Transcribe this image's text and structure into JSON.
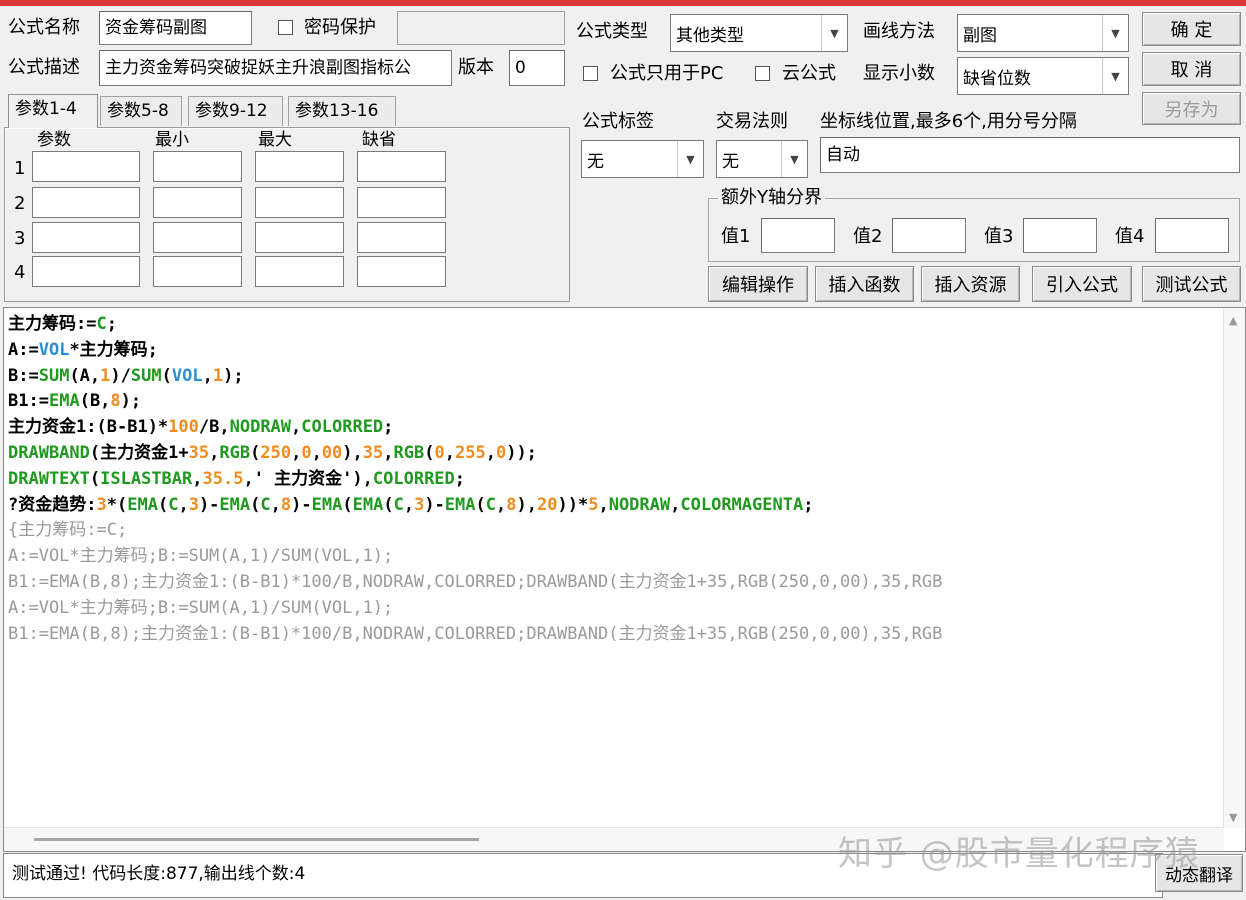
{
  "form": {
    "name_label": "公式名称",
    "name_value": "资金筹码副图",
    "password_label": "密码保护",
    "desc_label": "公式描述",
    "desc_value": "主力资金筹码突破捉妖主升浪副图指标公",
    "version_label": "版本",
    "version_value": "0",
    "type_label": "公式类型",
    "type_value": "其他类型",
    "draw_label": "画线方法",
    "draw_value": "副图",
    "pc_only_label": "公式只用于PC",
    "cloud_label": "云公式",
    "decimal_label": "显示小数",
    "decimal_value": "缺省位数",
    "tag_label": "公式标签",
    "tag_value": "无",
    "trade_label": "交易法则",
    "trade_value": "无",
    "coord_label": "坐标线位置,最多6个,用分号分隔",
    "coord_value": "自动",
    "ybound_label": "额外Y轴分界",
    "ybound_values": [
      "值1",
      "值2",
      "值3",
      "值4"
    ]
  },
  "buttons": {
    "ok": "确  定",
    "cancel": "取  消",
    "save_as": "另存为",
    "edit_ops": "编辑操作",
    "insert_func": "插入函数",
    "insert_res": "插入资源",
    "import_formula": "引入公式",
    "test_formula": "测试公式",
    "dynamic_translate": "动态翻译"
  },
  "tabs": [
    "参数1-4",
    "参数5-8",
    "参数9-12",
    "参数13-16"
  ],
  "params": {
    "headers": [
      "参数",
      "最小",
      "最大",
      "缺省"
    ],
    "rows": [
      "1",
      "2",
      "3",
      "4"
    ]
  },
  "code_lines": [
    "主力筹码:=C;",
    "A:=VOL*主力筹码;",
    "B:=SUM(A,1)/SUM(VOL,1);",
    "B1:=EMA(B,8);",
    "主力资金1:(B-B1)*100/B,NODRAW,COLORRED;",
    "DRAWBAND(主力资金1+35,RGB(250,0,00),35,RGB(0,255,0));",
    "DRAWTEXT(ISLASTBAR,35.5,' 主力资金'),COLORRED;",
    "?资金趋势:3*(EMA(C,3)-EMA(C,8)-EMA(EMA(C,3)-EMA(C,8),20))*5,NODRAW,COLORMAGENTA;",
    "{主力筹码:=C;",
    "A:=VOL*主力筹码;B:=SUM(A,1)/SUM(VOL,1);",
    "B1:=EMA(B,8);主力资金1:(B-B1)*100/B,NODRAW,COLORRED;DRAWBAND(主力资金1+35,RGB(250,0,00),35,RGB",
    "A:=VOL*主力筹码;B:=SUM(A,1)/SUM(VOL,1);",
    "B1:=EMA(B,8);主力资金1:(B-B1)*100/B,NODRAW,COLORRED;DRAWBAND(主力资金1+35,RGB(250,0,00),35,RGB"
  ],
  "status_text": "测试通过! 代码长度:877,输出线个数:4",
  "watermark": "知乎 @股市量化程序猿",
  "colors": {
    "title_bar": "#d9383a",
    "keyword": "#1f9a1f",
    "number": "#f08c1e",
    "variable": "#2a8fd0"
  }
}
